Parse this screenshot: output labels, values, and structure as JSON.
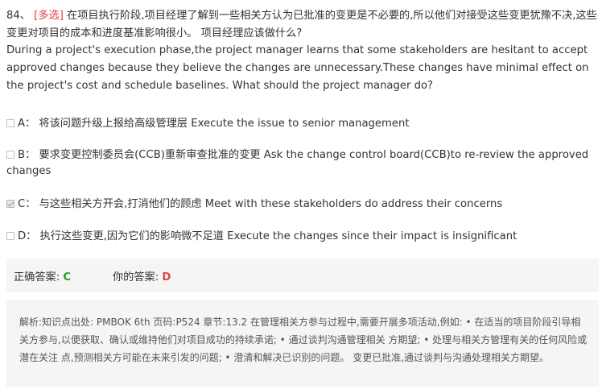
{
  "question": {
    "number": "84、",
    "type_tag": "[多选]",
    "text_cn": "在项目执行阶段,项目经理了解到一些相关方认为已批准的变更是不必要的,所以他们对接受这些变更犹豫不决,这些变更对项目的成本和进度基准影响很小。 项目经理应该做什么?",
    "text_en": "During a project's execution phase,the project manager learns that some stakeholders are hesitant to accept approved changes because they believe the changes are unnecessary.These changes have minimal effect on the project's cost and schedule baselines. What should the project manager do?"
  },
  "options": [
    {
      "label": "A：",
      "text": "将该问题升级上报给高级管理层 Execute the issue to senior management",
      "checked": false
    },
    {
      "label": "B：",
      "text": "要求变更控制委员会(CCB)重新审查批准的变更 Ask the change control board(CCB)to re-review the approved changes",
      "checked": false
    },
    {
      "label": "C：",
      "text": "与这些相关方开会,打消他们的顾虑 Meet with these stakeholders do address their concerns",
      "checked": true
    },
    {
      "label": "D：",
      "text": "执行这些变更,因为它们的影响微不足道 Execute the changes since their impact is insignificant",
      "checked": false
    }
  ],
  "answers": {
    "correct_label": "正确答案:",
    "correct_value": "C",
    "user_label": "你的答案:",
    "user_value": "D"
  },
  "explanation": "解析:知识点出处: PMBOK 6th 页码:P524 章节:13.2 在管理相关方参与过程中,需要开展多项活动,例如: • 在适当的项目阶段引导相关方参与,以便获取、确认或维持他们对项目成功的持续承诺; • 通过谈判沟通管理相关 方期望; • 处理与相关方管理有关的任何风险或潜在关注 点,预测相关方可能在未来引发的问题; • 澄清和解决已识别的问题。 变更已批准,通过谈判与沟通处理相关方期望。"
}
